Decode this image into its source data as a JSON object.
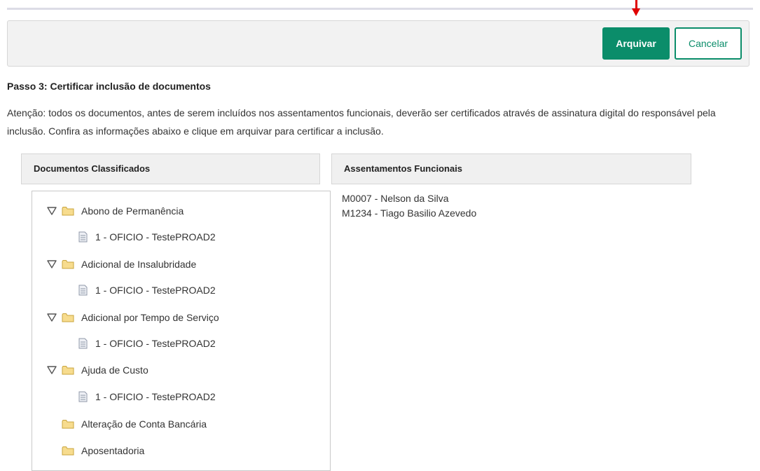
{
  "toolbar": {
    "archive_label": "Arquivar",
    "cancel_label": "Cancelar"
  },
  "step": {
    "title": "Passo 3: Certificar inclusão de documentos",
    "notice": "Atenção: todos os documentos, antes de serem incluídos nos assentamentos funcionais, deverão ser certificados através de assinatura digital do responsável pela inclusão. Confira as informações abaixo e clique em arquivar para certificar a inclusão."
  },
  "documents": {
    "header": "Documentos Classificados",
    "folders": [
      {
        "label": "Abono de Permanência",
        "expanded": true,
        "files": [
          "1 - OFICIO - TestePROAD2"
        ]
      },
      {
        "label": "Adicional de Insalubridade",
        "expanded": true,
        "files": [
          "1 - OFICIO - TestePROAD2"
        ]
      },
      {
        "label": "Adicional por Tempo de Serviço",
        "expanded": true,
        "files": [
          "1 - OFICIO - TestePROAD2"
        ]
      },
      {
        "label": "Ajuda de Custo",
        "expanded": true,
        "files": [
          "1 - OFICIO - TestePROAD2"
        ]
      },
      {
        "label": "Alteração de Conta Bancária",
        "expanded": false,
        "files": []
      },
      {
        "label": "Aposentadoria",
        "expanded": false,
        "files": []
      }
    ]
  },
  "records": {
    "header": "Assentamentos Funcionais",
    "people": [
      "M0007 - Nelson da Silva",
      "M1234 - Tiago Basilio Azevedo"
    ]
  },
  "colors": {
    "primary": "#0b8d6a",
    "annotation_arrow": "#e00000",
    "folder_fill": "#f7dc8e",
    "folder_stroke": "#c9a43c"
  },
  "icons": {
    "expanded": "triangle-down-icon",
    "folder": "folder-icon",
    "file": "file-icon"
  }
}
